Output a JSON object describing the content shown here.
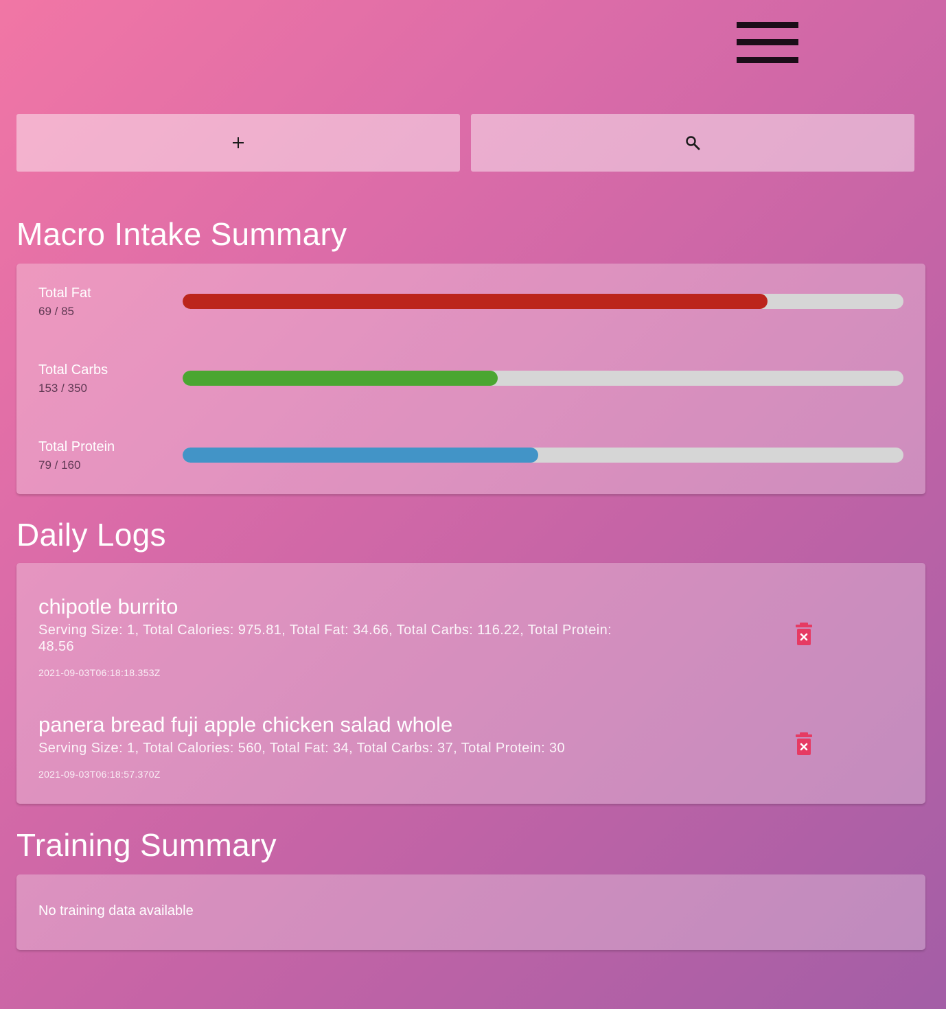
{
  "toolbar": {
    "add_icon": "plus-icon",
    "search_icon": "search-icon"
  },
  "macro_summary": {
    "title": "Macro Intake Summary",
    "items": [
      {
        "label": "Total Fat",
        "value_text": "69 / 85",
        "consumed": 69,
        "goal": 85,
        "color": "#bc251c"
      },
      {
        "label": "Total Carbs",
        "value_text": "153 / 350",
        "consumed": 153,
        "goal": 350,
        "color": "#4aa631"
      },
      {
        "label": "Total Protein",
        "value_text": "79 / 160",
        "consumed": 79,
        "goal": 160,
        "color": "#4294c7"
      }
    ]
  },
  "daily_logs": {
    "title": "Daily Logs",
    "entries": [
      {
        "name": "chipotle burrito",
        "details": "Serving Size: 1, Total Calories: 975.81, Total Fat: 34.66, Total Carbs: 116.22, Total Protein: 48.56",
        "timestamp": "2021-09-03T06:18:18.353Z"
      },
      {
        "name": "panera bread fuji apple chicken salad whole",
        "details": "Serving Size: 1, Total Calories: 560, Total Fat: 34, Total Carbs: 37, Total Protein: 30",
        "timestamp": "2021-09-03T06:18:57.370Z"
      }
    ],
    "delete_icon_color": "#e63a63"
  },
  "training_summary": {
    "title": "Training Summary",
    "empty_text": "No training data available"
  }
}
